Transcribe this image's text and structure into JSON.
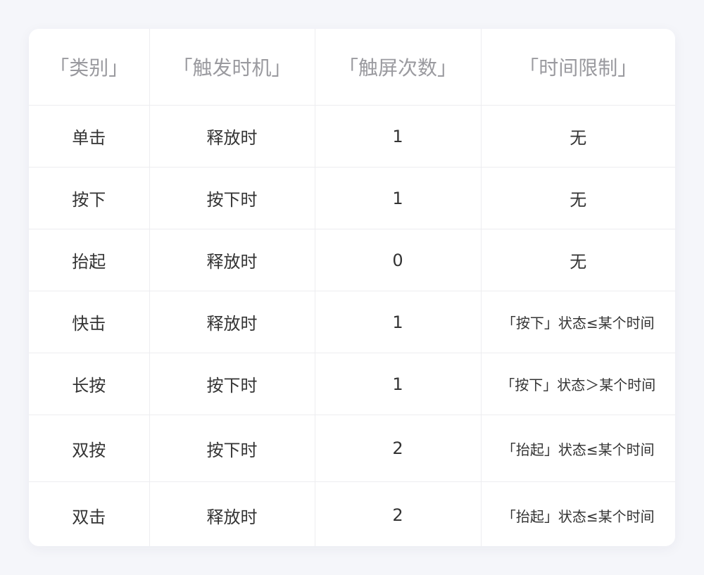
{
  "headers": [
    "「类别」",
    "「触发时机」",
    "「触屏次数」",
    "「时间限制」"
  ],
  "rows": [
    [
      "单击",
      "释放时",
      "1",
      "无"
    ],
    [
      "按下",
      "按下时",
      "1",
      "无"
    ],
    [
      "抬起",
      "释放时",
      "0",
      "无"
    ],
    [
      "快击",
      "释放时",
      "1",
      "「按下」状态≤某个时间"
    ],
    [
      "长按",
      "按下时",
      "1",
      "「按下」状态＞某个时间"
    ],
    [
      "双按",
      "按下时",
      "2",
      "「抬起」状态≤某个时间"
    ],
    [
      "双击",
      "释放时",
      "2",
      "「抬起」状态≤某个时间"
    ]
  ]
}
